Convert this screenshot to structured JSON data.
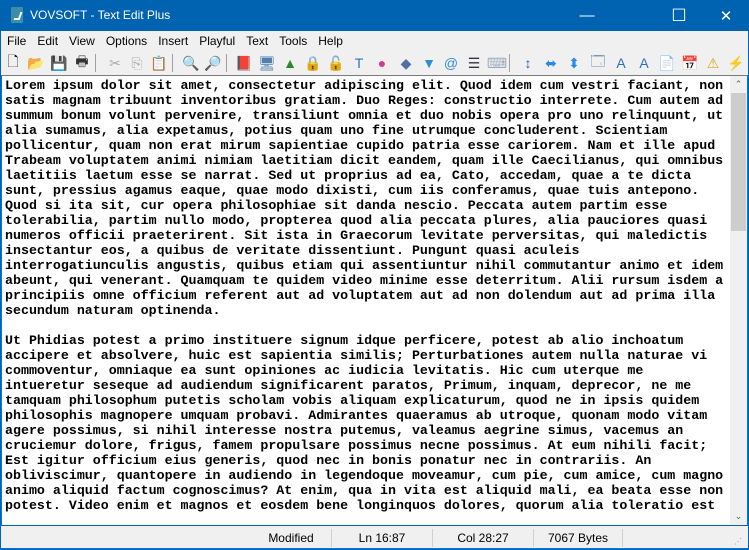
{
  "window": {
    "title": "VOVSOFT - Text Edit Plus",
    "minimize": "—",
    "maximize": "☐",
    "close": "✕"
  },
  "menu": [
    "File",
    "Edit",
    "View",
    "Options",
    "Insert",
    "Playful",
    "Text",
    "Tools",
    "Help"
  ],
  "toolbar": [
    {
      "name": "new-file-icon",
      "glyph": "🗋"
    },
    {
      "name": "open-folder-icon",
      "glyph": "📂"
    },
    {
      "name": "save-icon",
      "glyph": "💾"
    },
    {
      "name": "print-icon",
      "glyph": "🖶"
    },
    {
      "name": "cut-icon",
      "glyph": "✂"
    },
    {
      "name": "copy-icon",
      "glyph": "⎘"
    },
    {
      "name": "paste-icon",
      "glyph": "📋"
    },
    {
      "name": "find-icon",
      "glyph": "🔍"
    },
    {
      "name": "replace-icon",
      "glyph": "🔎"
    },
    {
      "name": "help-book-icon",
      "glyph": "📕"
    },
    {
      "name": "monitor-icon",
      "glyph": "🖥"
    },
    {
      "name": "triangle-chart-icon",
      "glyph": "▲"
    },
    {
      "name": "lock-icon",
      "glyph": "🔒"
    },
    {
      "name": "unlock-icon",
      "glyph": "🔓"
    },
    {
      "name": "text-format-icon",
      "glyph": "T"
    },
    {
      "name": "color-wheel-icon",
      "glyph": "●"
    },
    {
      "name": "plugin-icon",
      "glyph": "◆"
    },
    {
      "name": "filter-icon",
      "glyph": "▼"
    },
    {
      "name": "email-at-icon",
      "glyph": "@"
    },
    {
      "name": "numbered-list-icon",
      "glyph": "☰"
    },
    {
      "name": "keyboard-icon",
      "glyph": "⌨"
    },
    {
      "name": "line-spacing-icon",
      "glyph": "↕"
    },
    {
      "name": "horizontal-arrows-icon",
      "glyph": "⬌"
    },
    {
      "name": "vertical-arrows-icon",
      "glyph": "⬍"
    },
    {
      "name": "window-icon",
      "glyph": "🗔"
    },
    {
      "name": "font-up-icon",
      "glyph": "A"
    },
    {
      "name": "font-down-icon",
      "glyph": "A"
    },
    {
      "name": "document-icon",
      "glyph": "📄"
    },
    {
      "name": "calendar-icon",
      "glyph": "📅"
    },
    {
      "name": "warning-icon",
      "glyph": "⚠"
    },
    {
      "name": "quick-action-icon",
      "glyph": "⚡"
    }
  ],
  "editor": {
    "content": "Lorem ipsum dolor sit amet, consectetur adipiscing elit. Quod idem cum vestri faciant, non\nsatis magnam tribuunt inventoribus gratiam. Duo Reges: constructio interrete. Cum autem ad\nsummum bonum volunt pervenire, transiliunt omnia et duo nobis opera pro uno relinquunt, ut\nalia sumamus, alia expetamus, potius quam uno fine utrumque concluderent. Scientiam\npollicentur, quam non erat mirum sapientiae cupido patria esse cariorem. Nam et ille apud\nTrabeam voluptatem animi nimiam laetitiam dicit eandem, quam ille Caecilianus, qui omnibus\nlaetitiis laetum esse se narrat. Sed ut proprius ad ea, Cato, accedam, quae a te dicta\nsunt, pressius agamus eaque, quae modo dixisti, cum iis conferamus, quae tuis antepono.\nQuod si ita sit, cur opera philosophiae sit danda nescio. Peccata autem partim esse\ntolerabilia, partim nullo modo, propterea quod alia peccata plures, alia pauciores quasi\nnumeros officii praeterirent. Sit ista in Graecorum levitate perversitas, qui maledictis\ninsectantur eos, a quibus de veritate dissentiunt. Pungunt quasi aculeis\ninterrogatiunculis angustis, quibus etiam qui assentiuntur nihil commutantur animo et idem\nabeunt, qui venerant. Quamquam te quidem video minime esse deterritum. Alii rursum isdem a\nprincipiis omne officium referent aut ad voluptatem aut ad non dolendum aut ad prima illa\nsecundum naturam optinenda.\n\nUt Phidias potest a primo instituere signum idque perficere, potest ab alio inchoatum\naccipere et absolvere, huic est sapientia similis; Perturbationes autem nulla naturae vi\ncommoventur, omniaque ea sunt opiniones ac iudicia levitatis. Hic cum uterque me\nintueretur seseque ad audiendum significarent paratos, Primum, inquam, deprecor, ne me\ntamquam philosophum putetis scholam vobis aliquam explicaturum, quod ne in ipsis quidem\nphilosophis magnopere umquam probavi. Admirantes quaeramus ab utroque, quonam modo vitam\nagere possimus, si nihil interesse nostra putemus, valeamus aegrine simus, vacemus an\ncruciemur dolore, frigus, famem propulsare possimus necne possimus. At eum nihili facit;\nEst igitur officium eius generis, quod nec in bonis ponatur nec in contrariis. An\nobliviscimur, quantopere in audiendo in legendoque moveamur, cum pie, cum amice, cum magno\nanimo aliquid factum cognoscimus? At enim, qua in vita est aliquid mali, ea beata esse non\npotest. Video enim et magnos et eosdem bene longinquos dolores, quorum alia toleratio est",
    "scroll_up": "⌃",
    "scroll_down": "⌄"
  },
  "status": {
    "state": "Modified",
    "line": "Ln 16:87",
    "col": "Col 28:27",
    "size": "7067 Bytes"
  }
}
